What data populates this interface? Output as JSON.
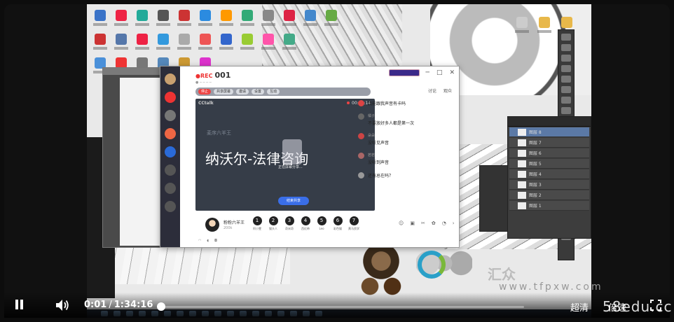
{
  "app": {
    "title_no": "001",
    "record_label": "停止",
    "toolbar": [
      "共享屏幕",
      "邀请",
      "设置",
      "互动"
    ],
    "side_tabs": [
      "讨论",
      "观众"
    ],
    "stage_logo": "CCtalk",
    "stage_time": "00:00:14",
    "stage_small": "麦序六羊王",
    "headline": "纳沃尔-法律咨询",
    "share_text": "正在屏幕分享...",
    "share_button": "结束共享",
    "presenter": {
      "name": "粉粉六羊王",
      "status": "200k"
    },
    "participants": [
      {
        "no": "1",
        "name": "阿小雯"
      },
      {
        "no": "2",
        "name": "猫头人"
      },
      {
        "no": "3",
        "name": "奇米奇"
      },
      {
        "no": "4",
        "name": "西红柿"
      },
      {
        "no": "5",
        "name": "Leo"
      },
      {
        "no": "6",
        "name": "彩色猫"
      },
      {
        "no": "7",
        "name": "黄马良学"
      }
    ],
    "chat": [
      {
        "name": "",
        "text": "我能跟我声音有卡吗"
      },
      {
        "name": "橘子",
        "text": "不要放好多人都是第一次"
      },
      {
        "name": "朵朵",
        "text": "没听见声音"
      },
      {
        "name": "若若",
        "text": "没听到声音"
      },
      {
        "name": "",
        "text": "还有总在吗？"
      }
    ]
  },
  "layers": [
    "图层 8",
    "图层 7",
    "图层 6",
    "图层 5",
    "图层 4",
    "图层 3",
    "图层 2",
    "图层 1"
  ],
  "watermark": {
    "text": "汇众",
    "url": "www.tfpxw.com"
  },
  "player": {
    "current_time": "0:01",
    "separator": "/",
    "duration": "1:34:16",
    "progress": 0.001,
    "quality": "超清",
    "speed": "倍速",
    "brand": "58edu.cc"
  }
}
